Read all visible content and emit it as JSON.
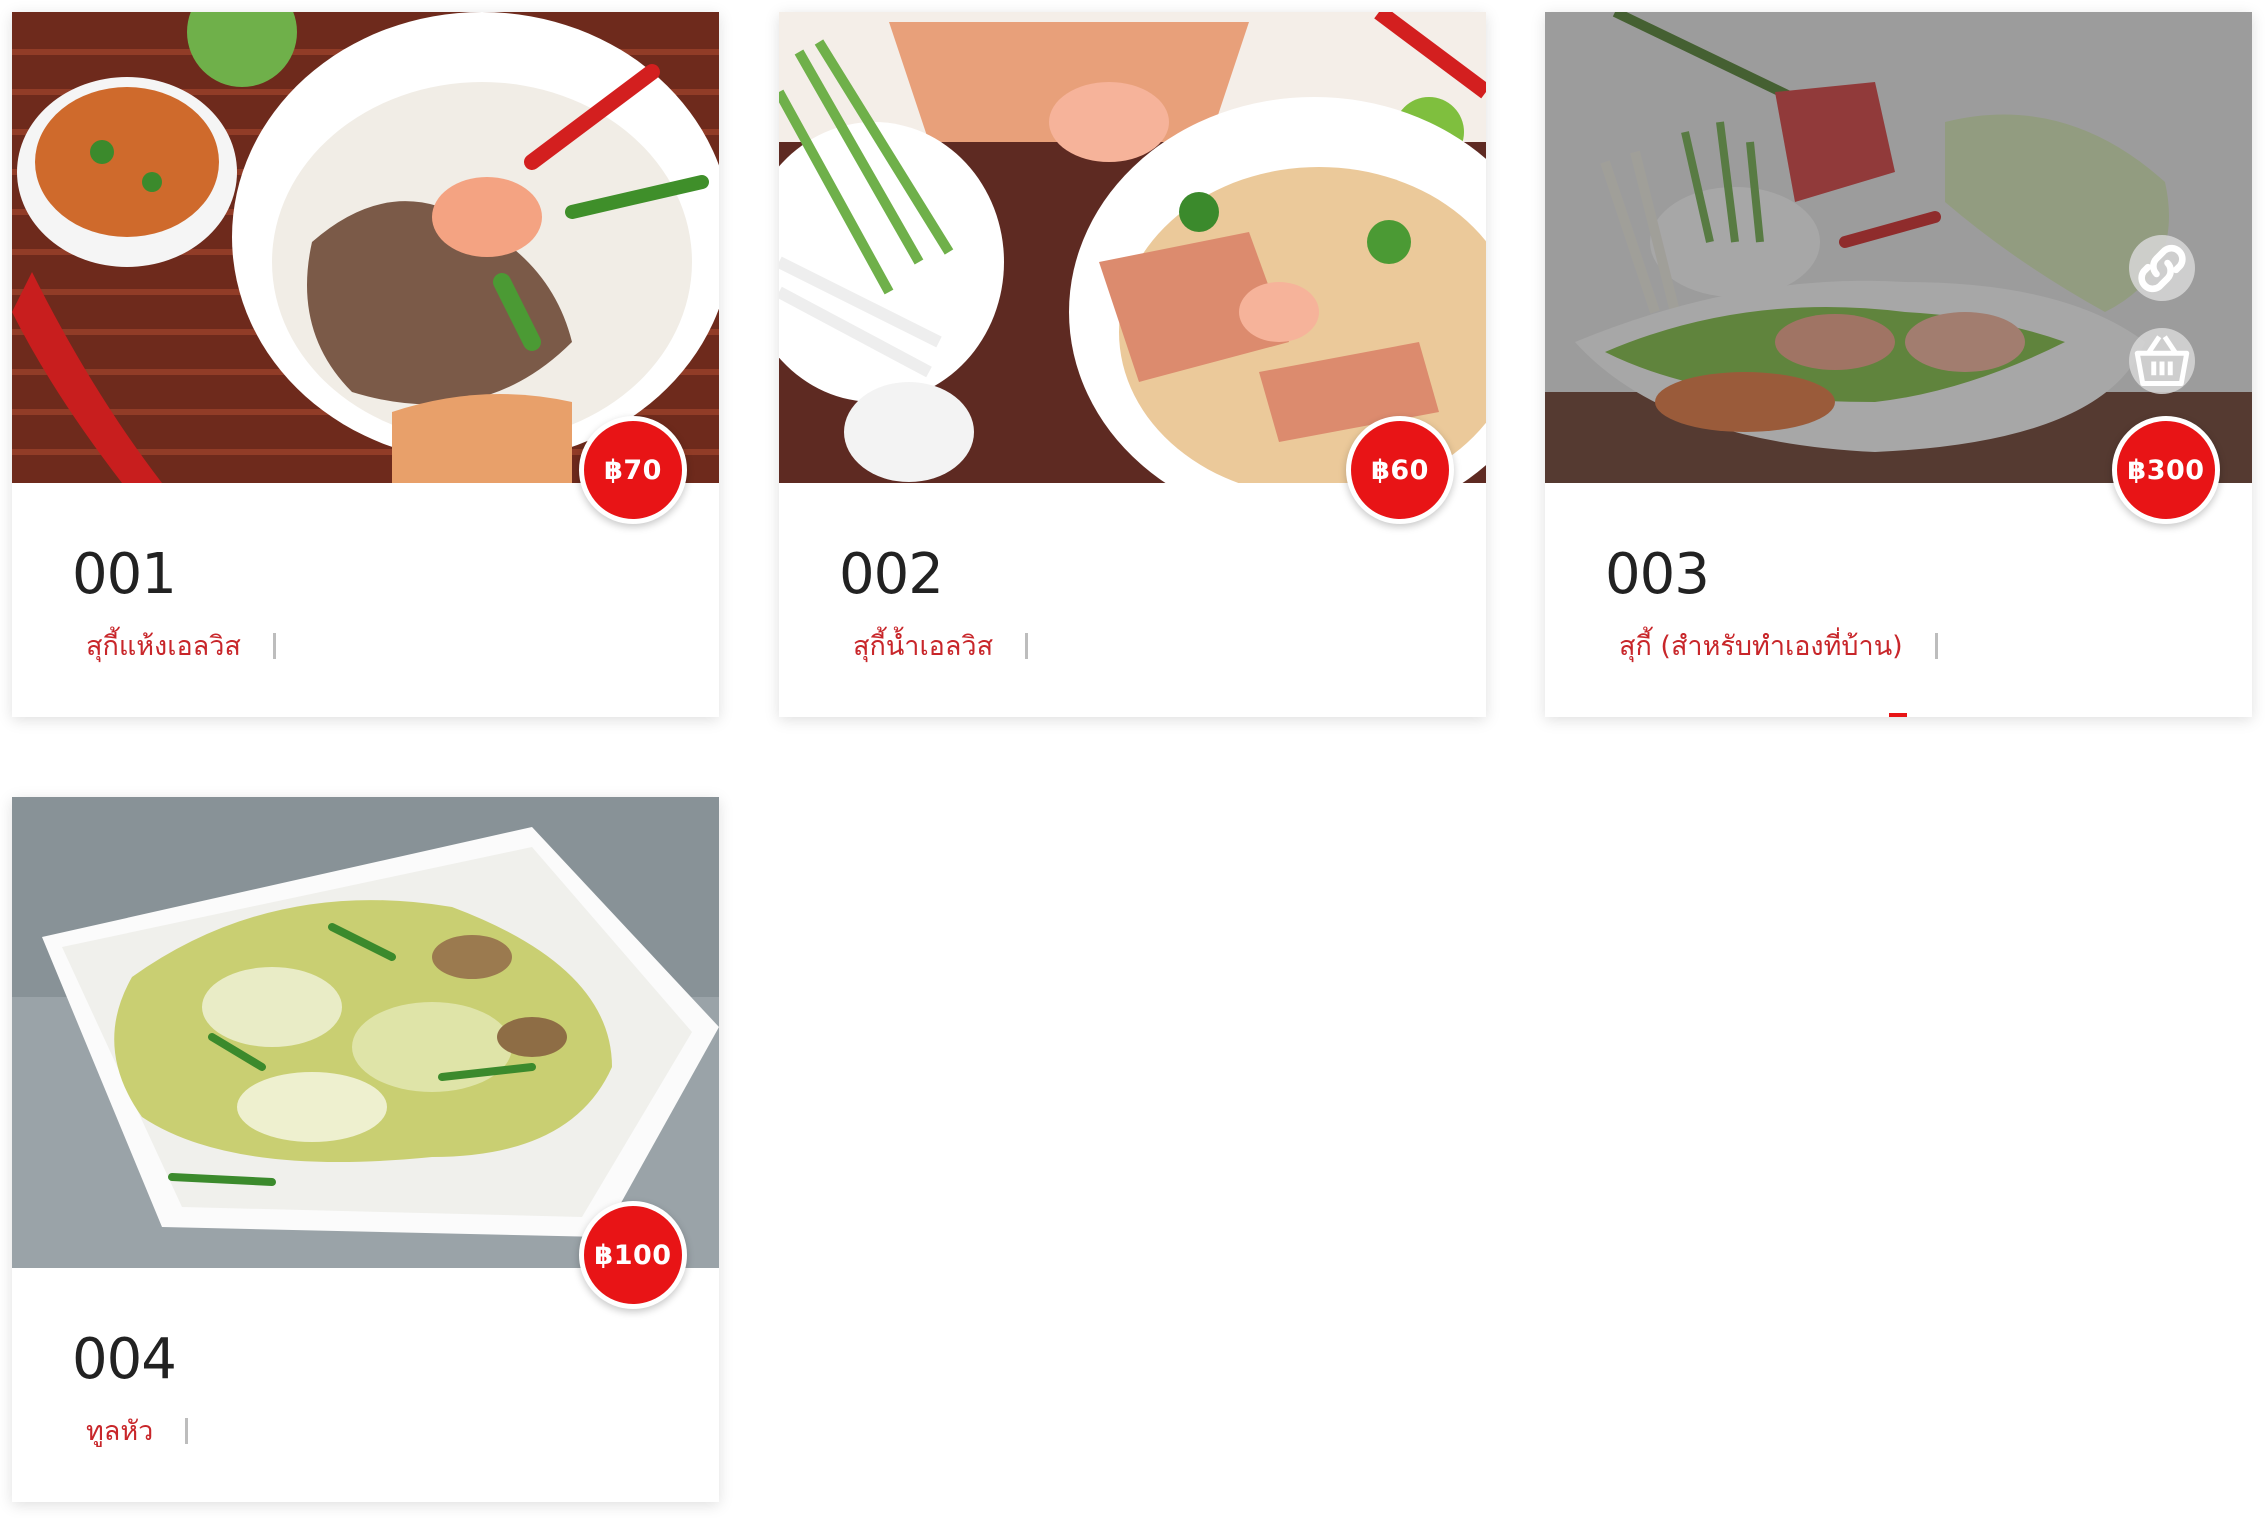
{
  "colors": {
    "accent": "#e81416",
    "item_name": "#c8262a",
    "item_code": "#222222"
  },
  "items": [
    {
      "code": "001",
      "name": "สุกี้แห้งเอลวิส",
      "price": "฿70"
    },
    {
      "code": "002",
      "name": "สุกี้น้ำเอลวิส",
      "price": "฿60"
    },
    {
      "code": "003",
      "name": "สุกี้ (สำหรับทำเองที่บ้าน)",
      "price": "฿300",
      "hover_actions": [
        "link-icon",
        "basket-icon"
      ]
    },
    {
      "code": "004",
      "name": "ทูลหัว",
      "price": "฿100"
    }
  ]
}
